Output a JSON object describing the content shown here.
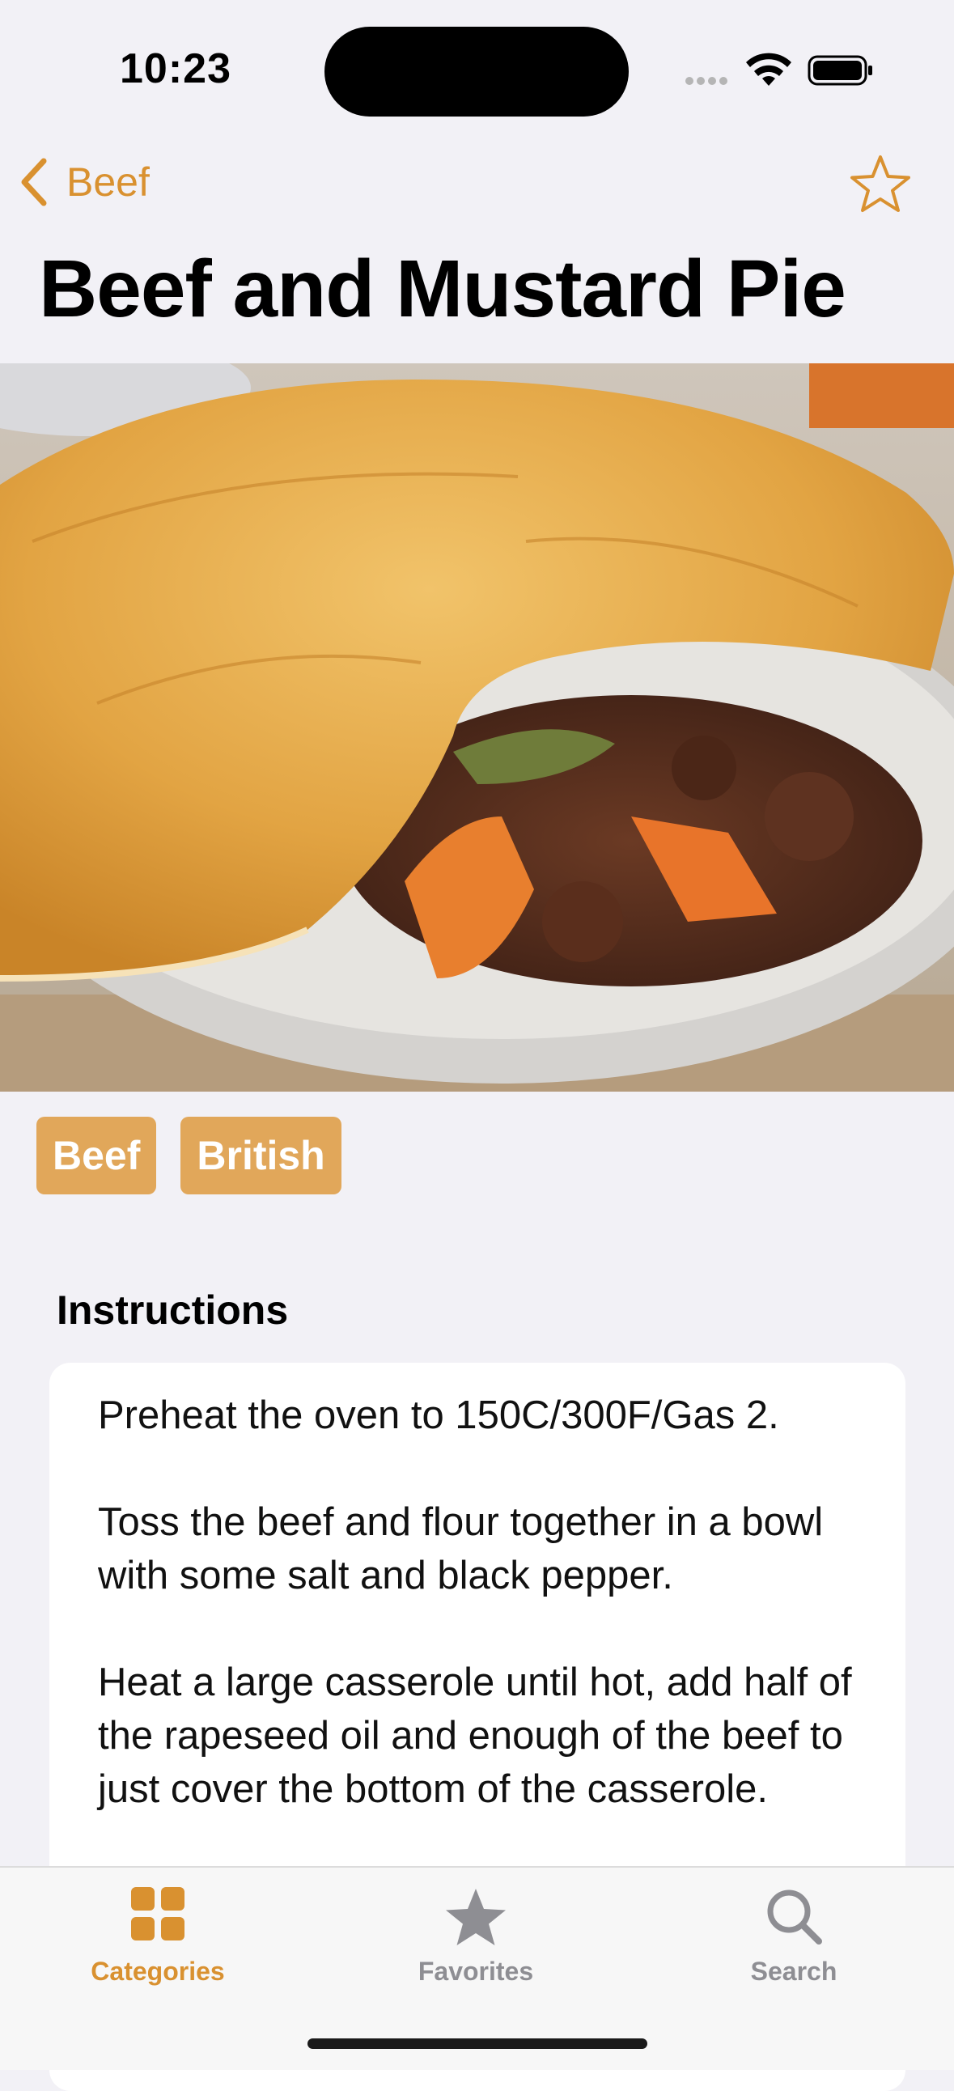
{
  "status_bar": {
    "time": "10:23"
  },
  "nav": {
    "back_label": "Beef",
    "favorite_icon": "star-outline-icon"
  },
  "recipe": {
    "title": "Beef and Mustard Pie",
    "tags": [
      "Beef",
      "British"
    ]
  },
  "instructions": {
    "heading": "Instructions",
    "paragraphs": [
      "Preheat the oven to 150C/300F/Gas 2.",
      "Toss the beef and flour together in a bowl with some salt and black pepper.",
      "Heat a large casserole until hot, add half of the rapeseed oil and enough of the beef to just cover the bottom of the casserole."
    ]
  },
  "tab_bar": {
    "tabs": [
      {
        "label": "Categories",
        "icon": "grid-icon",
        "selected": true
      },
      {
        "label": "Favorites",
        "icon": "star-icon",
        "selected": false
      },
      {
        "label": "Search",
        "icon": "search-icon",
        "selected": false
      }
    ]
  },
  "colors": {
    "accent": "#d99130",
    "tag_background": "#e1a75a",
    "inactive_tab": "#8e8e93",
    "background": "#f2f1f6"
  }
}
